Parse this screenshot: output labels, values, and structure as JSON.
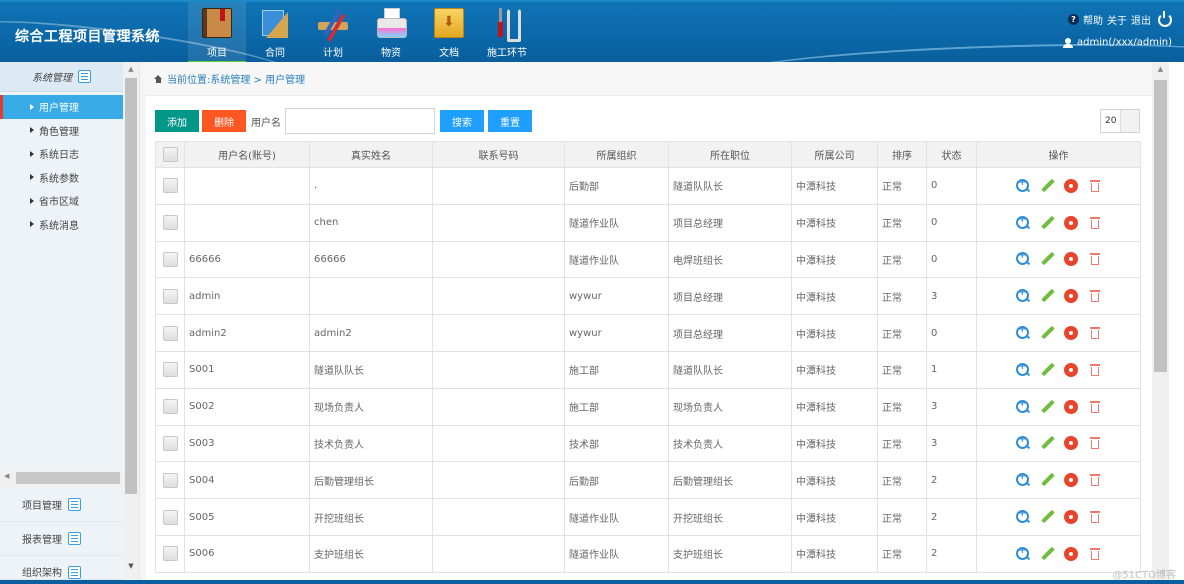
{
  "header": {
    "app_title": "综合工程项目管理系统",
    "nav": [
      {
        "label": "项目",
        "icon": "book-icon",
        "active": true
      },
      {
        "label": "合同",
        "icon": "ruler-icon",
        "active": false
      },
      {
        "label": "计划",
        "icon": "plan-icon",
        "active": false
      },
      {
        "label": "物资",
        "icon": "printer-icon",
        "active": false
      },
      {
        "label": "文档",
        "icon": "folder-icon",
        "active": false
      },
      {
        "label": "施工环节",
        "icon": "tools-icon",
        "active": false
      }
    ],
    "help": "帮助",
    "about": "关于",
    "logout": "退出",
    "user": "admin(/xxx/admin)"
  },
  "sidebar": {
    "section_title": "系统管理",
    "items": [
      {
        "label": "用户管理",
        "active": true
      },
      {
        "label": "角色管理"
      },
      {
        "label": "系统日志"
      },
      {
        "label": "系统参数"
      },
      {
        "label": "省市区域"
      },
      {
        "label": "系统消息"
      }
    ],
    "groups": [
      {
        "label": "项目管理"
      },
      {
        "label": "报表管理"
      },
      {
        "label": "组织架构"
      }
    ]
  },
  "breadcrumb": {
    "prefix": "当前位置:",
    "path": "系统管理 > 用户管理"
  },
  "toolbar": {
    "add_label": "添加",
    "delete_label": "删除",
    "username_label": "用户名",
    "username_value": "",
    "search_label": "搜索",
    "reset_label": "重置",
    "page_size": "20"
  },
  "table": {
    "columns": [
      "用户名(账号)",
      "真实姓名",
      "联系号码",
      "所属组织",
      "所在职位",
      "所属公司",
      "排序",
      "状态",
      "操作"
    ],
    "rows": [
      {
        "username": "",
        "realname": ".",
        "phone": "",
        "org": "后勤部",
        "position": "隧道队队长",
        "company": "中潭科技",
        "sort": "正常",
        "status": "0"
      },
      {
        "username": "",
        "realname": "chen",
        "phone": "",
        "org": "隧道作业队",
        "position": "项目总经理",
        "company": "中潭科技",
        "sort": "正常",
        "status": "0"
      },
      {
        "username": "66666",
        "realname": "66666",
        "phone": "",
        "org": "隧道作业队",
        "position": "电焊班组长",
        "company": "中潭科技",
        "sort": "正常",
        "status": "0"
      },
      {
        "username": "admin",
        "realname": "",
        "phone": "",
        "org": "wywur",
        "position": "项目总经理",
        "company": "中潭科技",
        "sort": "正常",
        "status": "3"
      },
      {
        "username": "admin2",
        "realname": "admin2",
        "phone": "",
        "org": "wywur",
        "position": "项目总经理",
        "company": "中潭科技",
        "sort": "正常",
        "status": "0"
      },
      {
        "username": "S001",
        "realname": "隧道队队长",
        "phone": "",
        "org": "施工部",
        "position": "隧道队队长",
        "company": "中潭科技",
        "sort": "正常",
        "status": "1"
      },
      {
        "username": "S002",
        "realname": "现场负责人",
        "phone": "",
        "org": "施工部",
        "position": "现场负责人",
        "company": "中潭科技",
        "sort": "正常",
        "status": "3"
      },
      {
        "username": "S003",
        "realname": "技术负责人",
        "phone": "",
        "org": "技术部",
        "position": "技术负责人",
        "company": "中潭科技",
        "sort": "正常",
        "status": "3"
      },
      {
        "username": "S004",
        "realname": "后勤管理组长",
        "phone": "",
        "org": "后勤部",
        "position": "后勤管理组长",
        "company": "中潭科技",
        "sort": "正常",
        "status": "2"
      },
      {
        "username": "S005",
        "realname": "开挖班组长",
        "phone": "",
        "org": "隧道作业队",
        "position": "开挖班组长",
        "company": "中潭科技",
        "sort": "正常",
        "status": "2"
      },
      {
        "username": "S006",
        "realname": "支护班组长",
        "phone": "",
        "org": "隧道作业队",
        "position": "支护班组长",
        "company": "中潭科技",
        "sort": "正常",
        "status": "2"
      }
    ],
    "row_actions": [
      "view-icon",
      "edit-icon",
      "settings-icon",
      "delete-icon"
    ]
  },
  "watermark": "@51CTO博客",
  "colors": {
    "header_bg": "#0b67a8",
    "sidebar_active": "#38aae6",
    "add_button": "#009688",
    "delete_button": "#ff5722",
    "search_button": "#1e9fff",
    "nav_active_indicator": "#5fd12e"
  }
}
